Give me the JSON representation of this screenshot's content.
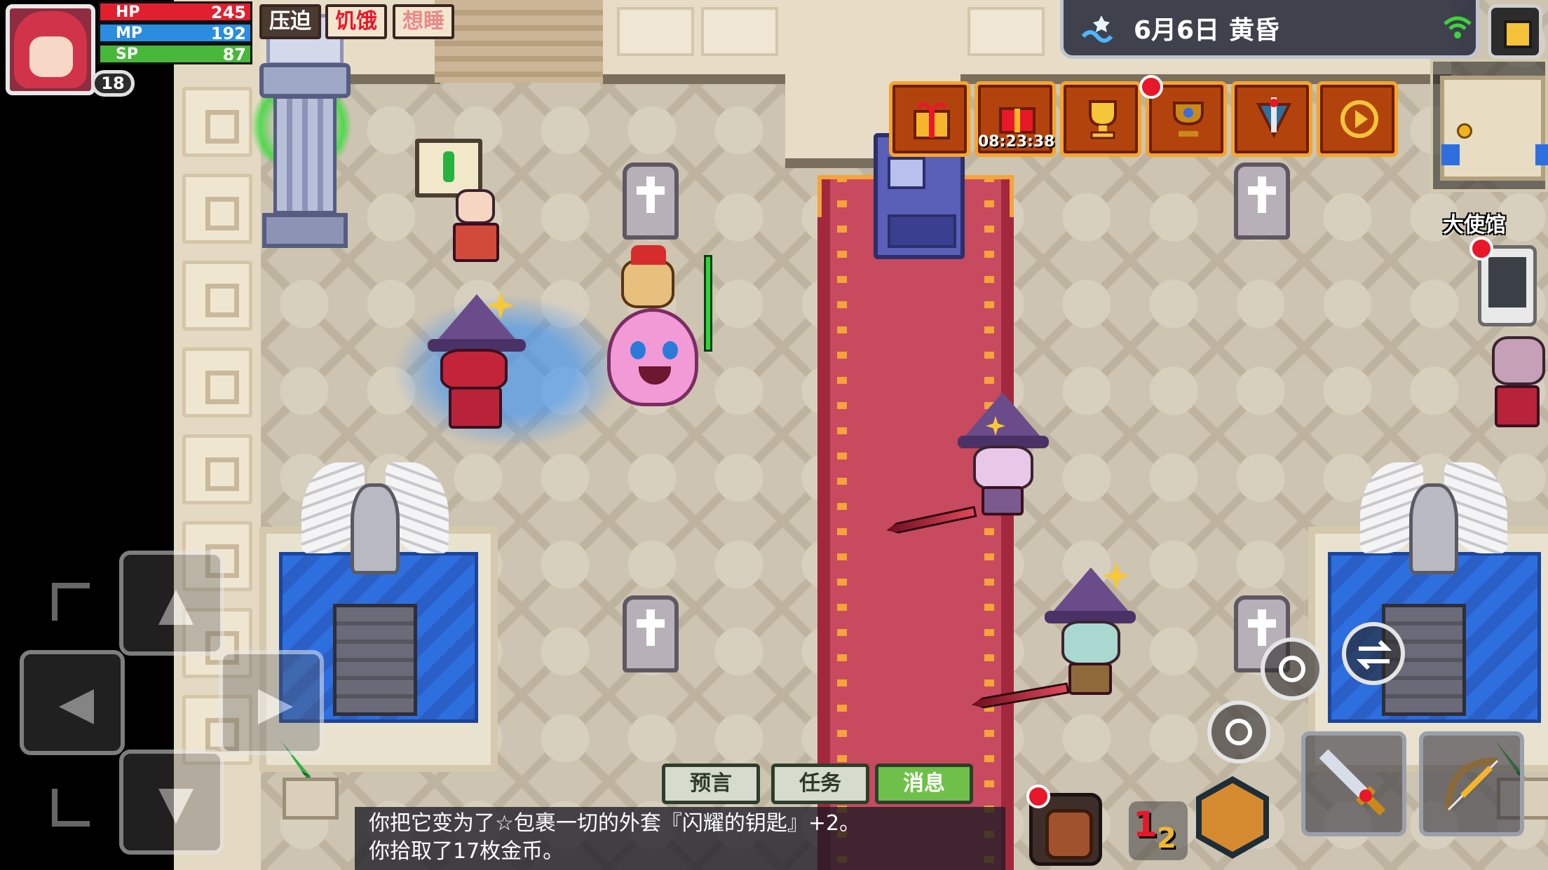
{
  "player": {
    "level": "18",
    "hp_label": "HP",
    "hp_value": "245",
    "hp_fraction": 1.0,
    "mp_label": "MP",
    "mp_value": "192",
    "mp_fraction": 1.0,
    "sp_label": "SP",
    "sp_value": "87",
    "sp_fraction": 1.0
  },
  "status_effects": [
    {
      "label": "压迫",
      "color": "#ffffff",
      "bg": "#4a3a30"
    },
    {
      "label": "饥饿",
      "color": "#e8172a",
      "bg": "#f3e6cf"
    },
    {
      "label": "想睡",
      "color": "#e88a8a",
      "bg": "#f3e6cf"
    }
  ],
  "datebar": {
    "date": "6月6日",
    "time_of_day": "黄昏",
    "weather_icon": "wave-icon",
    "signal_icon": "wifi-icon"
  },
  "top_icons": [
    {
      "name": "gift-icon",
      "timer": ""
    },
    {
      "name": "gift-timer-icon",
      "timer": "08:23:38"
    },
    {
      "name": "trophy-icon",
      "timer": ""
    },
    {
      "name": "cup-icon",
      "timer": ""
    },
    {
      "name": "sword-badge-icon",
      "timer": ""
    },
    {
      "name": "play-icon",
      "timer": ""
    }
  ],
  "location_label": "大使馆",
  "chat_tabs": [
    {
      "label": "预言",
      "active": false
    },
    {
      "label": "任务",
      "active": false
    },
    {
      "label": "消息",
      "active": true
    }
  ],
  "messages": [
    "你把它变为了☆包裹一切的外套『闪耀的钥匙』+2。",
    "你拾取了17枚金币。"
  ],
  "hotkey": {
    "primary": "1",
    "secondary": "2"
  },
  "colors": {
    "hp": "#e0202e",
    "mp": "#2a8de0",
    "sp": "#48b83a",
    "accent_orange": "#f5a52c",
    "carpet": "#c84a5e"
  }
}
